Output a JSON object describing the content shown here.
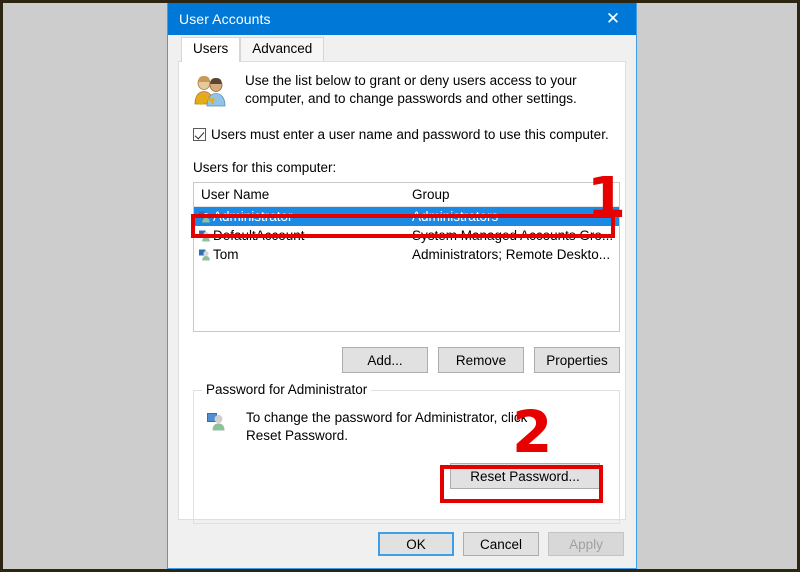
{
  "window": {
    "title": "User Accounts",
    "close_label": "✕"
  },
  "tabs": [
    {
      "label": "Users",
      "active": true
    },
    {
      "label": "Advanced",
      "active": false
    }
  ],
  "users_tab": {
    "intro_icon": "users-key-icon",
    "intro_text": "Use the list below to grant or deny users access to your computer, and to change passwords and other settings.",
    "checkbox": {
      "label": "Users must enter a user name and password to use this computer.",
      "checked": true
    },
    "list_caption": "Users for this computer:",
    "list": {
      "columns": [
        "User Name",
        "Group"
      ],
      "rows": [
        {
          "user_name": "Administrator",
          "group": "Administrators",
          "selected": true
        },
        {
          "user_name": "DefaultAccount",
          "group": "System Managed Accounts Gro...",
          "selected": false
        },
        {
          "user_name": "Tom",
          "group": "Administrators; Remote Deskto...",
          "selected": false
        }
      ]
    },
    "buttons": {
      "add": "Add...",
      "remove": "Remove",
      "properties": "Properties"
    },
    "password_group": {
      "title": "Password for Administrator",
      "icon": "single-user-icon",
      "description": "To change the password for Administrator, click Reset Password.",
      "reset_button": "Reset Password..."
    }
  },
  "footer": {
    "ok": "OK",
    "cancel": "Cancel",
    "apply": "Apply"
  },
  "annotations": [
    {
      "number": "1",
      "target": "selected-user-row"
    },
    {
      "number": "2",
      "target": "reset-password-button"
    }
  ],
  "colors": {
    "titlebar": "#0078d7",
    "selection": "#1a8ae5",
    "annotation": "#e60000",
    "desktop": "#cdcdcd"
  }
}
